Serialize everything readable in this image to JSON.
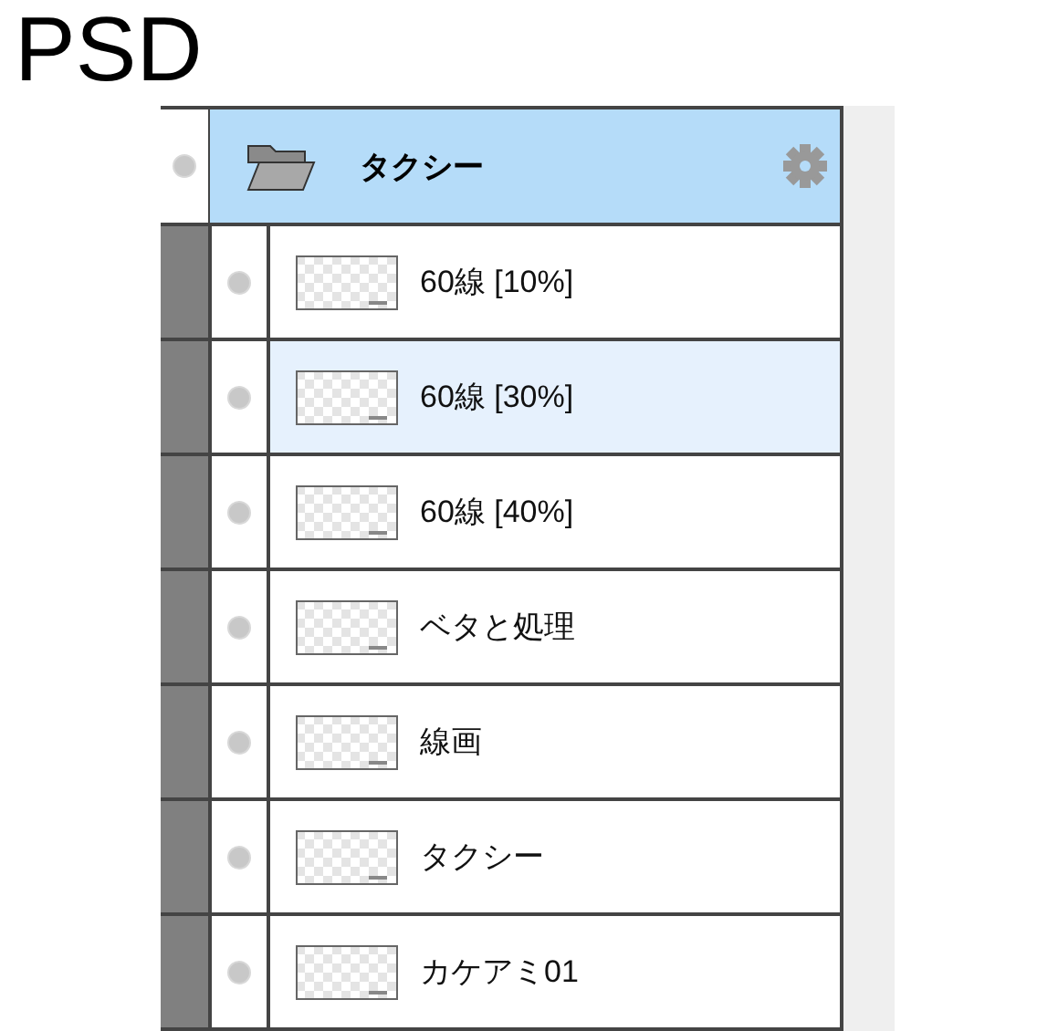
{
  "title": "PSD",
  "folder": {
    "name": "タクシー",
    "expanded": true,
    "layers": [
      {
        "name": "60線 [10%]",
        "selected": false
      },
      {
        "name": "60線 [30%]",
        "selected": true
      },
      {
        "name": "60線 [40%]",
        "selected": false
      },
      {
        "name": "ベタと処理",
        "selected": false
      },
      {
        "name": "線画",
        "selected": false
      },
      {
        "name": "タクシー",
        "selected": false
      },
      {
        "name": "カケアミ01",
        "selected": false
      }
    ]
  }
}
